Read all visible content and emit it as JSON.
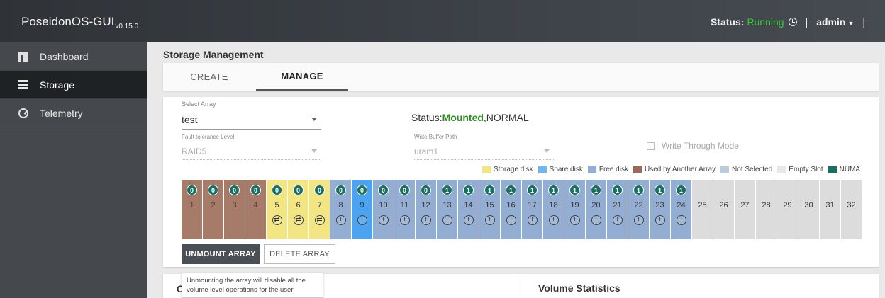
{
  "header": {
    "app_name": "PoseidonOS-GUI",
    "version": "v0.15.0",
    "status_label": "Status:",
    "status_value": "Running",
    "separator": "|",
    "user": "admin"
  },
  "sidebar": {
    "items": [
      {
        "label": "Dashboard",
        "icon": "dashboard-icon"
      },
      {
        "label": "Storage",
        "icon": "storage-icon"
      },
      {
        "label": "Telemetry",
        "icon": "telemetry-icon"
      }
    ]
  },
  "page": {
    "title": "Storage Management",
    "tabs": [
      {
        "label": "CREATE"
      },
      {
        "label": "MANAGE"
      }
    ]
  },
  "manage": {
    "select_array_label": "Select Array",
    "select_array_value": "test",
    "status_prefix": "Status:",
    "status_mounted": "Mounted",
    "status_suffix": ",NORMAL",
    "fault_label": "Fault tolerance Level",
    "fault_value": "RAID5",
    "wb_label": "Write Buffer Path",
    "wb_value": "uram1",
    "write_through_label": "Write Through Mode",
    "legend": [
      {
        "label": "Storage disk",
        "color": "#f2e584"
      },
      {
        "label": "Spare disk",
        "color": "#6fb6f2"
      },
      {
        "label": "Free disk",
        "color": "#94aed3"
      },
      {
        "label": "Used by Another Array",
        "color": "#9a6a58"
      },
      {
        "label": "Not Selected",
        "color": "#bccad9"
      },
      {
        "label": "Empty Slot",
        "color": "#e8e8e8"
      },
      {
        "label": "NUMA",
        "color": "#1b6e62"
      }
    ],
    "slots": [
      {
        "num": "1",
        "numa": "0",
        "type": "used",
        "action": ""
      },
      {
        "num": "2",
        "numa": "0",
        "type": "used",
        "action": ""
      },
      {
        "num": "3",
        "numa": "0",
        "type": "used",
        "action": ""
      },
      {
        "num": "4",
        "numa": "0",
        "type": "used",
        "action": ""
      },
      {
        "num": "5",
        "numa": "0",
        "type": "storage",
        "action": "⇄"
      },
      {
        "num": "6",
        "numa": "0",
        "type": "storage",
        "action": "⇄"
      },
      {
        "num": "7",
        "numa": "0",
        "type": "storage",
        "action": "⇄"
      },
      {
        "num": "8",
        "numa": "0",
        "type": "free",
        "action": "+"
      },
      {
        "num": "9",
        "numa": "0",
        "type": "spare",
        "action": "−"
      },
      {
        "num": "10",
        "numa": "0",
        "type": "free",
        "action": "+"
      },
      {
        "num": "11",
        "numa": "0",
        "type": "free",
        "action": "+"
      },
      {
        "num": "12",
        "numa": "0",
        "type": "free",
        "action": "+"
      },
      {
        "num": "13",
        "numa": "1",
        "type": "free",
        "action": "+"
      },
      {
        "num": "14",
        "numa": "1",
        "type": "free",
        "action": "+"
      },
      {
        "num": "15",
        "numa": "1",
        "type": "free",
        "action": "+"
      },
      {
        "num": "16",
        "numa": "1",
        "type": "free",
        "action": "+"
      },
      {
        "num": "17",
        "numa": "1",
        "type": "free",
        "action": "+"
      },
      {
        "num": "18",
        "numa": "1",
        "type": "free",
        "action": "+"
      },
      {
        "num": "19",
        "numa": "1",
        "type": "free",
        "action": "+"
      },
      {
        "num": "20",
        "numa": "1",
        "type": "free",
        "action": "+"
      },
      {
        "num": "21",
        "numa": "1",
        "type": "free",
        "action": "+"
      },
      {
        "num": "22",
        "numa": "1",
        "type": "free",
        "action": "+"
      },
      {
        "num": "23",
        "numa": "1",
        "type": "free",
        "action": "+"
      },
      {
        "num": "24",
        "numa": "1",
        "type": "free",
        "action": "+"
      },
      {
        "num": "25",
        "numa": "",
        "type": "empty",
        "action": ""
      },
      {
        "num": "26",
        "numa": "",
        "type": "empty",
        "action": ""
      },
      {
        "num": "27",
        "numa": "",
        "type": "empty",
        "action": ""
      },
      {
        "num": "28",
        "numa": "",
        "type": "empty",
        "action": ""
      },
      {
        "num": "29",
        "numa": "",
        "type": "empty",
        "action": ""
      },
      {
        "num": "30",
        "numa": "",
        "type": "empty",
        "action": ""
      },
      {
        "num": "31",
        "numa": "",
        "type": "empty",
        "action": ""
      },
      {
        "num": "32",
        "numa": "",
        "type": "empty",
        "action": ""
      }
    ],
    "unmount_label": "UNMOUNT ARRAY",
    "delete_label": "DELETE ARRAY"
  },
  "cards": {
    "left_title": "C",
    "right_title": "Volume Statistics"
  },
  "tooltip": {
    "text": "Unmounting the array will disable all the volume level operations for the user"
  }
}
